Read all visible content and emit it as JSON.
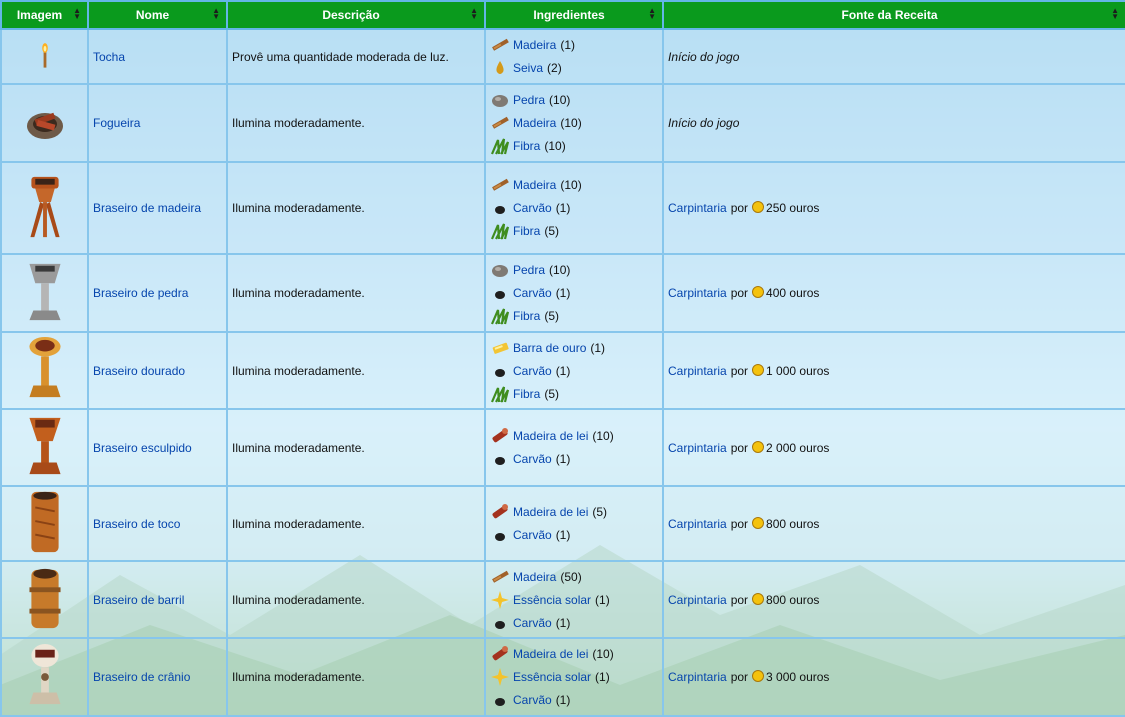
{
  "headers": [
    "Imagem",
    "Nome",
    "Descrição",
    "Ingredientes",
    "Fonte da Receita"
  ],
  "rows": [
    {
      "icon": "torch-icon",
      "name": "Tocha",
      "desc": "Provê uma quantidade moderada de luz.",
      "ingredients": [
        {
          "icon": "wood-icon",
          "name": "Madeira",
          "qty": "(1)"
        },
        {
          "icon": "sap-icon",
          "name": "Seiva",
          "qty": "(2)"
        }
      ],
      "source": {
        "type": "text",
        "text": "Início do jogo"
      }
    },
    {
      "icon": "campfire-icon",
      "name": "Fogueira",
      "desc": "Ilumina moderadamente.",
      "ingredients": [
        {
          "icon": "stone-icon",
          "name": "Pedra",
          "qty": "(10)"
        },
        {
          "icon": "wood-icon",
          "name": "Madeira",
          "qty": "(10)"
        },
        {
          "icon": "fiber-icon",
          "name": "Fibra",
          "qty": "(10)"
        }
      ],
      "source": {
        "type": "text",
        "text": "Início do jogo"
      }
    },
    {
      "icon": "wooden-brazier-icon",
      "name": "Braseiro de madeira",
      "desc": "Ilumina moderadamente.",
      "ingredients": [
        {
          "icon": "wood-icon",
          "name": "Madeira",
          "qty": "(10)"
        },
        {
          "icon": "coal-icon",
          "name": "Carvão",
          "qty": "(1)"
        },
        {
          "icon": "fiber-icon",
          "name": "Fibra",
          "qty": "(5)"
        }
      ],
      "source": {
        "type": "shop",
        "shop": "Carpintaria",
        "by": "por",
        "price": "250 ouros"
      }
    },
    {
      "icon": "stone-brazier-icon",
      "name": "Braseiro de pedra",
      "desc": "Ilumina moderadamente.",
      "ingredients": [
        {
          "icon": "stone-icon",
          "name": "Pedra",
          "qty": "(10)"
        },
        {
          "icon": "coal-icon",
          "name": "Carvão",
          "qty": "(1)"
        },
        {
          "icon": "fiber-icon",
          "name": "Fibra",
          "qty": "(5)"
        }
      ],
      "source": {
        "type": "shop",
        "shop": "Carpintaria",
        "by": "por",
        "price": "400 ouros"
      }
    },
    {
      "icon": "gold-brazier-icon",
      "name": "Braseiro dourado",
      "desc": "Ilumina moderadamente.",
      "ingredients": [
        {
          "icon": "gold-bar-icon",
          "name": "Barra de ouro",
          "qty": "(1)"
        },
        {
          "icon": "coal-icon",
          "name": "Carvão",
          "qty": "(1)"
        },
        {
          "icon": "fiber-icon",
          "name": "Fibra",
          "qty": "(5)"
        }
      ],
      "source": {
        "type": "shop",
        "shop": "Carpintaria",
        "by": "por",
        "price": "1 000 ouros"
      }
    },
    {
      "icon": "carved-brazier-icon",
      "name": "Braseiro esculpido",
      "desc": "Ilumina moderadamente.",
      "ingredients": [
        {
          "icon": "hardwood-icon",
          "name": "Madeira de lei",
          "qty": "(10)"
        },
        {
          "icon": "coal-icon",
          "name": "Carvão",
          "qty": "(1)"
        }
      ],
      "source": {
        "type": "shop",
        "shop": "Carpintaria",
        "by": "por",
        "price": "2 000 ouros"
      }
    },
    {
      "icon": "stump-brazier-icon",
      "name": "Braseiro de toco",
      "desc": "Ilumina moderadamente.",
      "ingredients": [
        {
          "icon": "hardwood-icon",
          "name": "Madeira de lei",
          "qty": "(5)"
        },
        {
          "icon": "coal-icon",
          "name": "Carvão",
          "qty": "(1)"
        }
      ],
      "source": {
        "type": "shop",
        "shop": "Carpintaria",
        "by": "por",
        "price": "800 ouros"
      }
    },
    {
      "icon": "barrel-brazier-icon",
      "name": "Braseiro de barril",
      "desc": "Ilumina moderadamente.",
      "ingredients": [
        {
          "icon": "wood-icon",
          "name": "Madeira",
          "qty": "(50)"
        },
        {
          "icon": "solar-essence-icon",
          "name": "Essência solar",
          "qty": "(1)"
        },
        {
          "icon": "coal-icon",
          "name": "Carvão",
          "qty": "(1)"
        }
      ],
      "source": {
        "type": "shop",
        "shop": "Carpintaria",
        "by": "por",
        "price": "800 ouros"
      }
    },
    {
      "icon": "skull-brazier-icon",
      "name": "Braseiro de crânio",
      "desc": "Ilumina moderadamente.",
      "ingredients": [
        {
          "icon": "hardwood-icon",
          "name": "Madeira de lei",
          "qty": "(10)"
        },
        {
          "icon": "solar-essence-icon",
          "name": "Essência solar",
          "qty": "(1)"
        },
        {
          "icon": "coal-icon",
          "name": "Carvão",
          "qty": "(1)"
        }
      ],
      "source": {
        "type": "shop",
        "shop": "Carpintaria",
        "by": "por",
        "price": "3 000 ouros"
      }
    }
  ]
}
